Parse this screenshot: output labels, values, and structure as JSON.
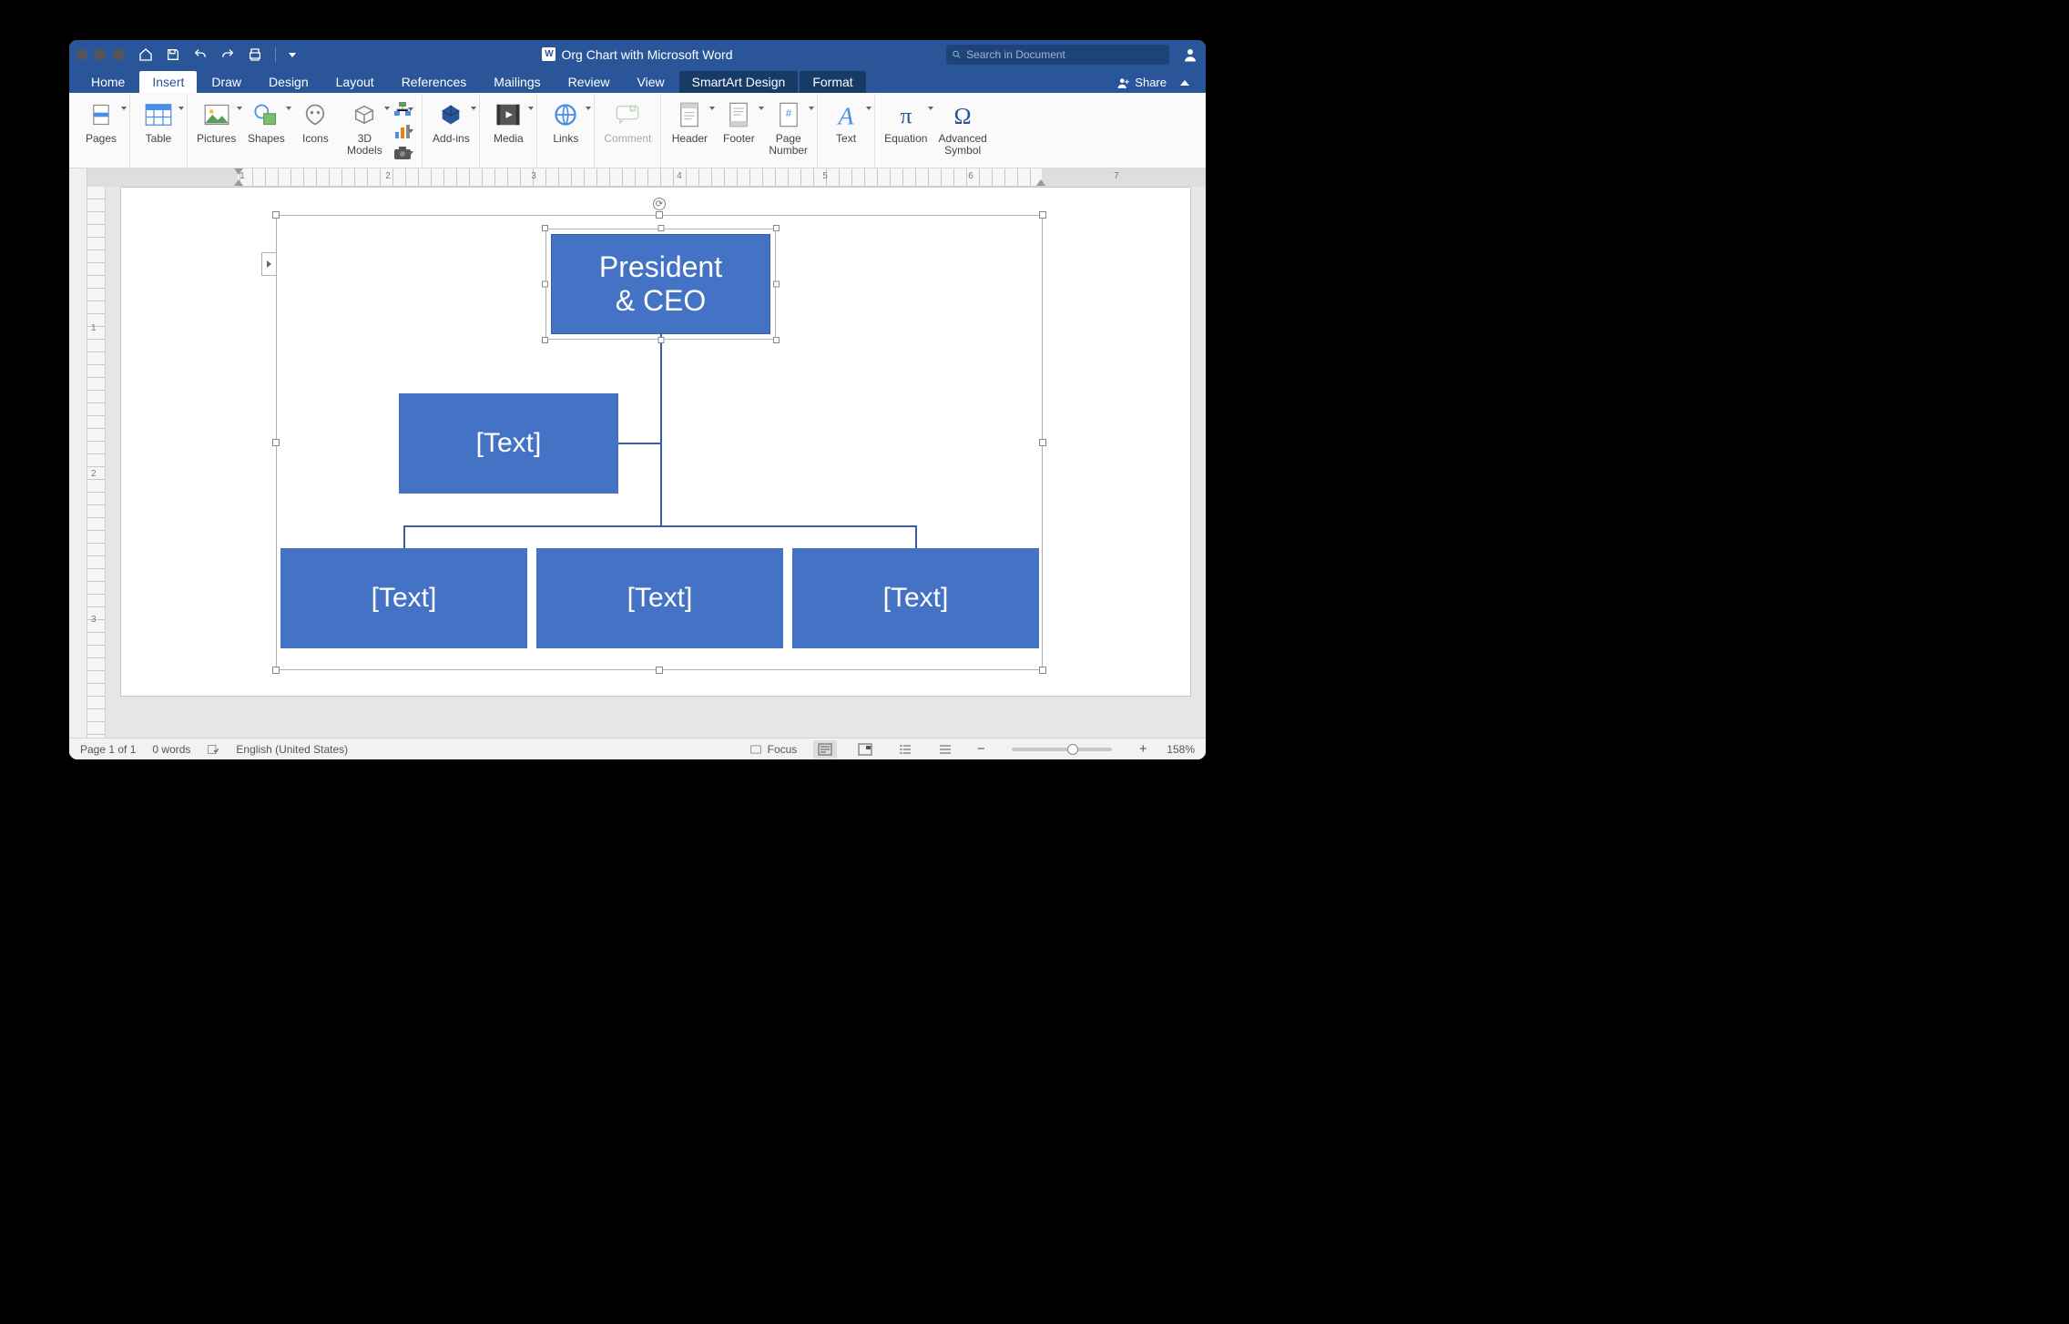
{
  "window": {
    "title": "Org Chart with Microsoft Word",
    "search_placeholder": "Search in Document",
    "share_label": "Share"
  },
  "tabs": {
    "home": "Home",
    "insert": "Insert",
    "draw": "Draw",
    "design": "Design",
    "layout": "Layout",
    "references": "References",
    "mailings": "Mailings",
    "review": "Review",
    "view": "View",
    "smartart_design": "SmartArt Design",
    "format": "Format",
    "active": "insert"
  },
  "ribbon": {
    "pages": "Pages",
    "table": "Table",
    "pictures": "Pictures",
    "shapes": "Shapes",
    "icons": "Icons",
    "models": "3D\nModels",
    "addins": "Add-ins",
    "media": "Media",
    "links": "Links",
    "comment": "Comment",
    "header": "Header",
    "footer": "Footer",
    "page_number": "Page\nNumber",
    "text": "Text",
    "equation": "Equation",
    "adv_symbol": "Advanced\nSymbol"
  },
  "ruler": {
    "h": [
      "1",
      "2",
      "3",
      "4",
      "5",
      "6",
      "7"
    ],
    "v": [
      "1",
      "2",
      "3"
    ]
  },
  "org": {
    "box_top": "President\n& CEO",
    "box_assist": "[Text]",
    "box_c1": "[Text]",
    "box_c2": "[Text]",
    "box_c3": "[Text]"
  },
  "status": {
    "page": "Page 1 of 1",
    "words": "0 words",
    "language": "English (United States)",
    "focus": "Focus",
    "zoom": "158%"
  },
  "chart_data": {
    "type": "org-chart",
    "root": {
      "label": "President & CEO",
      "assistant": {
        "label": "[Text]"
      },
      "children": [
        {
          "label": "[Text]"
        },
        {
          "label": "[Text]"
        },
        {
          "label": "[Text]"
        }
      ]
    }
  }
}
